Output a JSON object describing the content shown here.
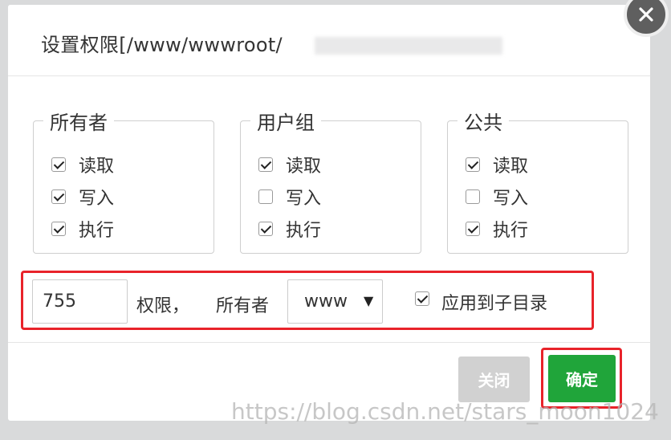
{
  "dialog": {
    "title": "设置权限[/www/wwwroot/",
    "close_icon": "close-icon"
  },
  "groups": [
    {
      "name": "所有者",
      "perms": [
        {
          "label": "读取",
          "checked": true
        },
        {
          "label": "写入",
          "checked": true
        },
        {
          "label": "执行",
          "checked": true
        }
      ]
    },
    {
      "name": "用户组",
      "perms": [
        {
          "label": "读取",
          "checked": true
        },
        {
          "label": "写入",
          "checked": false
        },
        {
          "label": "执行",
          "checked": true
        }
      ]
    },
    {
      "name": "公共",
      "perms": [
        {
          "label": "读取",
          "checked": true
        },
        {
          "label": "写入",
          "checked": false
        },
        {
          "label": "执行",
          "checked": true
        }
      ]
    }
  ],
  "settings": {
    "permission_value": "755",
    "permission_label": "权限，",
    "owner_label": "所有者",
    "owner_value": "www",
    "apply_subdir_label": "应用到子目录",
    "apply_subdir_checked": true
  },
  "buttons": {
    "close_label": "关闭",
    "ok_label": "确定"
  },
  "colors": {
    "highlight": "#e8232a",
    "ok_button": "#20a53a",
    "close_button": "#d1d1d1"
  },
  "watermark": "https://blog.csdn.net/stars_moon1024"
}
